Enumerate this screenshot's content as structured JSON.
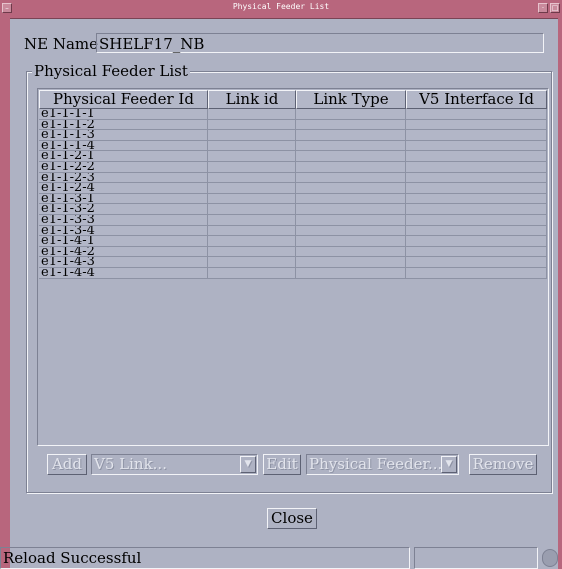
{
  "window": {
    "title": "Physical Feeder List"
  },
  "ne": {
    "label": "NE Name",
    "value": "SHELF17_NB"
  },
  "group": {
    "title": "Physical Feeder List"
  },
  "table": {
    "headers": [
      "Physical Feeder Id",
      "Link id",
      "Link Type",
      "V5 Interface Id"
    ],
    "rows": [
      [
        "e1-1-1-1",
        "",
        "",
        ""
      ],
      [
        "e1-1-1-2",
        "",
        "",
        ""
      ],
      [
        "e1-1-1-3",
        "",
        "",
        ""
      ],
      [
        "e1-1-1-4",
        "",
        "",
        ""
      ],
      [
        "e1-1-2-1",
        "",
        "",
        ""
      ],
      [
        "e1-1-2-2",
        "",
        "",
        ""
      ],
      [
        "e1-1-2-3",
        "",
        "",
        ""
      ],
      [
        "e1-1-2-4",
        "",
        "",
        ""
      ],
      [
        "e1-1-3-1",
        "",
        "",
        ""
      ],
      [
        "e1-1-3-2",
        "",
        "",
        ""
      ],
      [
        "e1-1-3-3",
        "",
        "",
        ""
      ],
      [
        "e1-1-3-4",
        "",
        "",
        ""
      ],
      [
        "e1-1-4-1",
        "",
        "",
        ""
      ],
      [
        "e1-1-4-2",
        "",
        "",
        ""
      ],
      [
        "e1-1-4-3",
        "",
        "",
        ""
      ],
      [
        "e1-1-4-4",
        "",
        "",
        ""
      ]
    ]
  },
  "actions": {
    "add_label": "Add",
    "v5link_value": "V5 Link...",
    "edit_label": "Edit",
    "physical_feeder_value": "Physical Feeder...",
    "remove_label": "Remove",
    "close_label": "Close",
    "combo_arrow_icon": "down-arrow-icon"
  },
  "status": {
    "text": "Reload Successful"
  },
  "colors": {
    "title_bar": "#b8667d",
    "window_bg": "#aeb2c3"
  }
}
